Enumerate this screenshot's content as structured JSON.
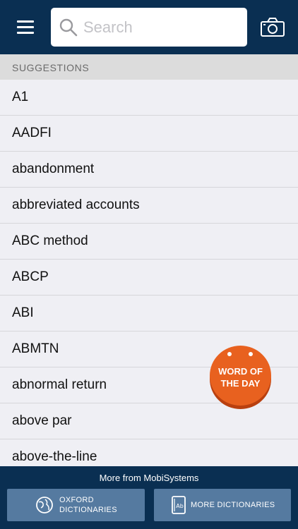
{
  "search": {
    "placeholder": "Search"
  },
  "suggestions": {
    "header": "SUGGESTIONS",
    "items": [
      "A1",
      "AADFI",
      "abandonment",
      "abbreviated accounts",
      "ABC method",
      "ABCP",
      "ABI",
      "ABMTN",
      "abnormal return",
      "above par",
      "above-the-line"
    ]
  },
  "word_of_day": {
    "line1": "WORD OF",
    "line2": "THE DAY"
  },
  "footer": {
    "title": "More from MobiSystems",
    "oxford_line1": "OXFORD",
    "oxford_line2": "DICTIONARIES",
    "more_label": "MORE DICTIONARIES"
  },
  "colors": {
    "navbar": "#0a2f52",
    "accent": "#e8611f",
    "footer_button": "#557aa0"
  },
  "icons": [
    "menu-icon",
    "search-icon",
    "camera-icon",
    "globe-icon",
    "dictionary-icon"
  ]
}
